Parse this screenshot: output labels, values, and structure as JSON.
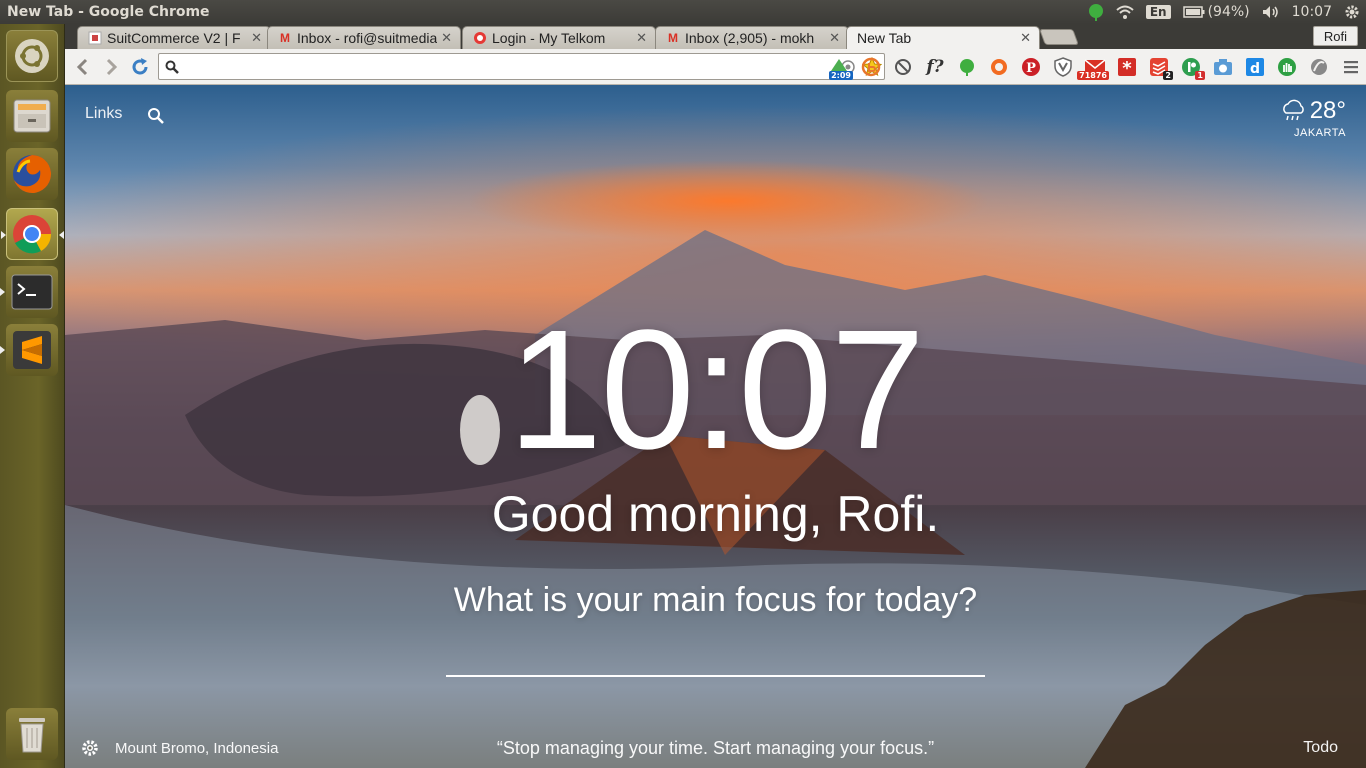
{
  "window": {
    "title": "New Tab - Google Chrome"
  },
  "panel": {
    "language": "En",
    "battery": "(94%)",
    "time": "10:07"
  },
  "launcher": {
    "items": [
      "ubuntu-dash-icon",
      "files-icon",
      "firefox-icon",
      "chrome-icon",
      "terminal-icon",
      "sublime-text-icon",
      "trash-icon"
    ]
  },
  "tabs": [
    {
      "title": "SuitCommerce V2 | F",
      "favicon": "suitcommerce-favicon"
    },
    {
      "title": "Inbox - rofi@suitmedia",
      "favicon": "gmail-favicon"
    },
    {
      "title": "Login - My Telkom",
      "favicon": "telkom-favicon"
    },
    {
      "title": "Inbox (2,905) - mokh",
      "favicon": "gmail-favicon"
    },
    {
      "title": "New Tab",
      "favicon": ""
    }
  ],
  "profile": {
    "name": "Rofi"
  },
  "omnibox": {
    "value": "",
    "placeholder": ""
  },
  "extensions": {
    "badges": {
      "timer": "2:09",
      "mail": "71876",
      "todoist": "2",
      "app": "1"
    }
  },
  "momentum": {
    "links_label": "Links",
    "weather": {
      "temp": "28°",
      "location": "JAKARTA"
    },
    "clock": "10:07",
    "greeting": "Good morning, Rofi.",
    "focus_question": "What is your main focus for today?",
    "photo_location": "Mount Bromo, Indonesia",
    "quote": "“Stop managing your time. Start managing your focus.”",
    "todo_label": "Todo"
  },
  "colors": {
    "panel_bg": "#3c3b37",
    "launcher_bg": "#6a6428",
    "toolbar_bg": "#f2f1ef",
    "text_light": "#dfdbd2"
  }
}
